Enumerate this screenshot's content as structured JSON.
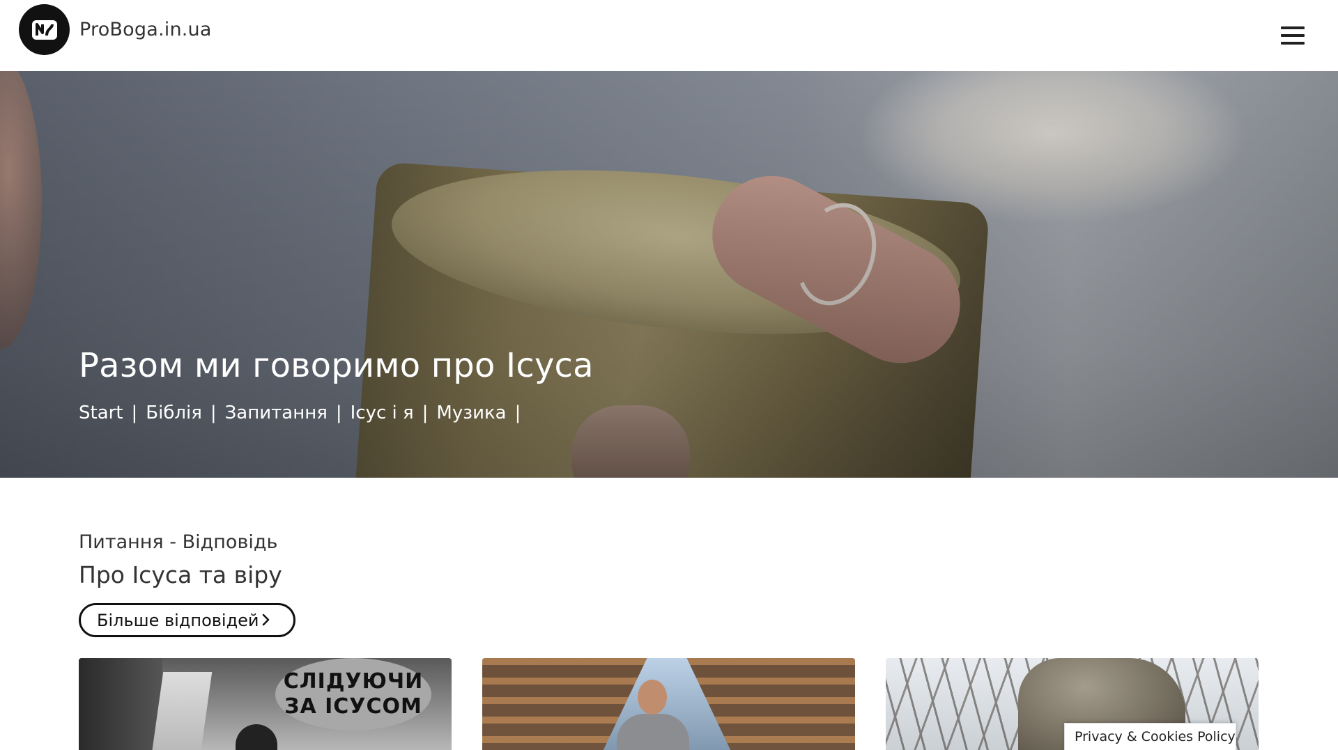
{
  "header": {
    "site_name": "ProBoga.in.ua",
    "logo_icon": "brand-logo",
    "menu_icon": "hamburger-menu-icon"
  },
  "hero": {
    "title": "Разом ми говоримо про Ісуса",
    "nav": [
      {
        "label": "Start"
      },
      {
        "label": "Біблія"
      },
      {
        "label": "Запитання"
      },
      {
        "label": "Ісус і я"
      },
      {
        "label": "Музика"
      }
    ],
    "separator": "|"
  },
  "section": {
    "subtitle": "Питання - Відповідь",
    "title": "Про Ісуса та віру",
    "more_button": "Більше відповідей"
  },
  "cards": [
    {
      "image_text_line1": "СЛІДУЮЧИ",
      "image_text_line2": "ЗА ІСУСОМ"
    },
    {},
    {}
  ],
  "cookie": {
    "label": "Privacy & Cookies Policy"
  },
  "colors": {
    "text_dark": "#222222",
    "header_bg": "#ffffff",
    "logo_bg": "#111111"
  }
}
